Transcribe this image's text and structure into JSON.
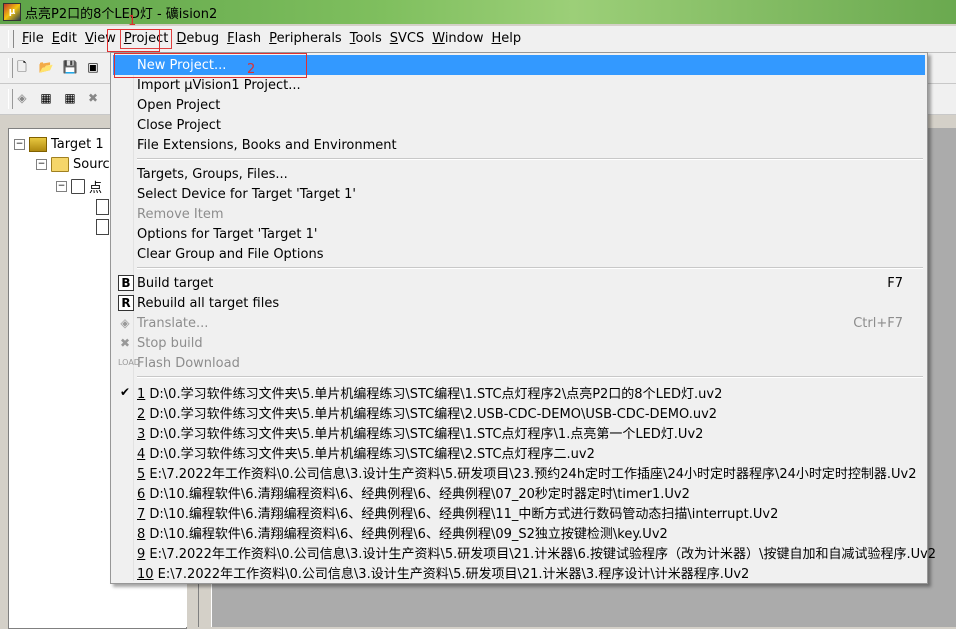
{
  "window": {
    "title": "点亮P2口的8个LED灯  - 礦ision2",
    "app_icon": "uv"
  },
  "menubar": {
    "items": [
      {
        "label": "File",
        "hotkey": "F"
      },
      {
        "label": "Edit",
        "hotkey": "E"
      },
      {
        "label": "View",
        "hotkey": "V"
      },
      {
        "label": "Project",
        "hotkey": "P"
      },
      {
        "label": "Debug",
        "hotkey": "D"
      },
      {
        "label": "Flash",
        "hotkey": "F"
      },
      {
        "label": "Peripherals",
        "hotkey": "P"
      },
      {
        "label": "Tools",
        "hotkey": "T"
      },
      {
        "label": "SVCS",
        "hotkey": "S"
      },
      {
        "label": "Window",
        "hotkey": "W"
      },
      {
        "label": "Help",
        "hotkey": "H"
      }
    ]
  },
  "annotations": {
    "marker_1": "1",
    "marker_2": "2"
  },
  "tree": {
    "target": "Target 1",
    "source": "Source",
    "file": "点"
  },
  "project_menu": {
    "new_project": "New Project...",
    "import_project": "Import µVision1 Project...",
    "open_project": "Open Project",
    "close_project": "Close Project",
    "file_extensions": "File Extensions, Books and Environment",
    "targets_groups": "Targets, Groups, Files...",
    "select_device": "Select Device for Target 'Target 1'",
    "remove_item": "Remove Item",
    "options_target": "Options for Target 'Target 1'",
    "clear_group": "Clear Group and File Options",
    "build_target": "Build target",
    "build_shortcut": "F7",
    "rebuild_all": "Rebuild all target files",
    "translate": "Translate...",
    "translate_shortcut": "Ctrl+F7",
    "stop_build": "Stop build",
    "flash_download": "Flash Download",
    "recent": [
      {
        "num": "1",
        "path": " D:\\0.学习软件练习文件夹\\5.单片机编程练习\\STC编程\\1.STC点灯程序2\\点亮P2口的8个LED灯.uv2"
      },
      {
        "num": "2",
        "path": " D:\\0.学习软件练习文件夹\\5.单片机编程练习\\STC编程\\2.USB-CDC-DEMO\\USB-CDC-DEMO.uv2"
      },
      {
        "num": "3",
        "path": " D:\\0.学习软件练习文件夹\\5.单片机编程练习\\STC编程\\1.STC点灯程序\\1.点亮第一个LED灯.Uv2"
      },
      {
        "num": "4",
        "path": " D:\\0.学习软件练习文件夹\\5.单片机编程练习\\STC编程\\2.STC点灯程序二.uv2"
      },
      {
        "num": "5",
        "path": " E:\\7.2022年工作资料\\0.公司信息\\3.设计生产资料\\5.研发项目\\23.预约24h定时工作插座\\24小时定时器程序\\24小时定时控制器.Uv2"
      },
      {
        "num": "6",
        "path": " D:\\10.编程软件\\6.清翔编程资料\\6、经典例程\\6、经典例程\\07_20秒定时器定时\\timer1.Uv2"
      },
      {
        "num": "7",
        "path": " D:\\10.编程软件\\6.清翔编程资料\\6、经典例程\\6、经典例程\\11_中断方式进行数码管动态扫描\\interrupt.Uv2"
      },
      {
        "num": "8",
        "path": " D:\\10.编程软件\\6.清翔编程资料\\6、经典例程\\6、经典例程\\09_S2独立按键检测\\key.Uv2"
      },
      {
        "num": "9",
        "path": " E:\\7.2022年工作资料\\0.公司信息\\3.设计生产资料\\5.研发项目\\21.计米器\\6.按键试验程序（改为计米器）\\按键自加和自减试验程序.Uv2"
      },
      {
        "num": "10",
        "path": " E:\\7.2022年工作资料\\0.公司信息\\3.设计生产资料\\5.研发项目\\21.计米器\\3.程序设计\\计米器程序.Uv2"
      }
    ],
    "checked_recent": "✔"
  },
  "colors": {
    "highlight": "#3399ff",
    "annotation": "#e03030",
    "workspace": "#ababab"
  }
}
